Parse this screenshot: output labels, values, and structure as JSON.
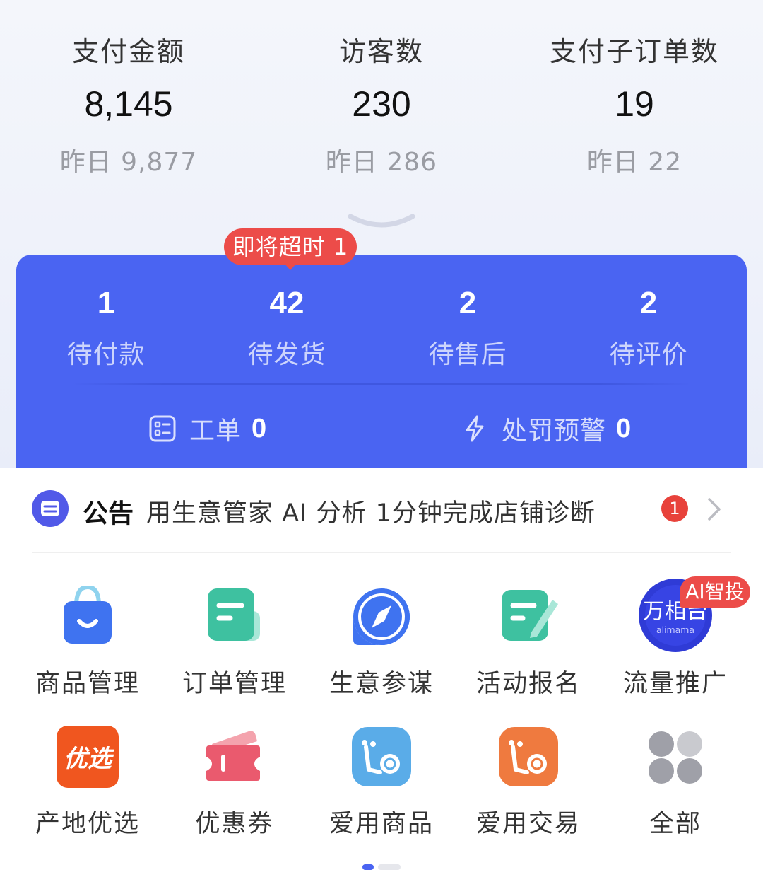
{
  "stats": [
    {
      "label": "支付金额",
      "value": "8,145",
      "yesterday": "昨日 9,877"
    },
    {
      "label": "访客数",
      "value": "230",
      "yesterday": "昨日 286"
    },
    {
      "label": "支付子订单数",
      "value": "19",
      "yesterday": "昨日 22"
    }
  ],
  "orders": {
    "timeout_badge": "即将超时 1",
    "items": [
      {
        "count": "1",
        "label": "待付款"
      },
      {
        "count": "42",
        "label": "待发货"
      },
      {
        "count": "2",
        "label": "待售后"
      },
      {
        "count": "2",
        "label": "待评价"
      }
    ],
    "ticket": {
      "label": "工单",
      "count": "0"
    },
    "penalty": {
      "label": "处罚预警",
      "count": "0"
    }
  },
  "notice": {
    "title": "公告",
    "text": "用生意管家 AI 分析 1分钟完成店铺诊断",
    "count": "1"
  },
  "grid": [
    {
      "label": "商品管理",
      "icon": "shopping-bag-icon"
    },
    {
      "label": "订单管理",
      "icon": "order-document-icon"
    },
    {
      "label": "生意参谋",
      "icon": "compass-icon"
    },
    {
      "label": "活动报名",
      "icon": "signup-pen-icon"
    },
    {
      "label": "流量推广",
      "icon": "wanxiangtai-logo",
      "logo_text": "万相台",
      "logo_sub": "alimama",
      "tag": "AI智投"
    },
    {
      "label": "产地优选",
      "icon": "youxuan-logo",
      "logo_text": "优选"
    },
    {
      "label": "优惠券",
      "icon": "coupon-icon"
    },
    {
      "label": "爱用商品",
      "icon": "snail-blue-icon"
    },
    {
      "label": "爱用交易",
      "icon": "snail-orange-icon"
    },
    {
      "label": "全部",
      "icon": "all-dots-icon"
    }
  ],
  "colors": {
    "primary_blue": "#4a64f2",
    "alert_red": "#ec4c49",
    "notice_purple": "#5159e8"
  }
}
